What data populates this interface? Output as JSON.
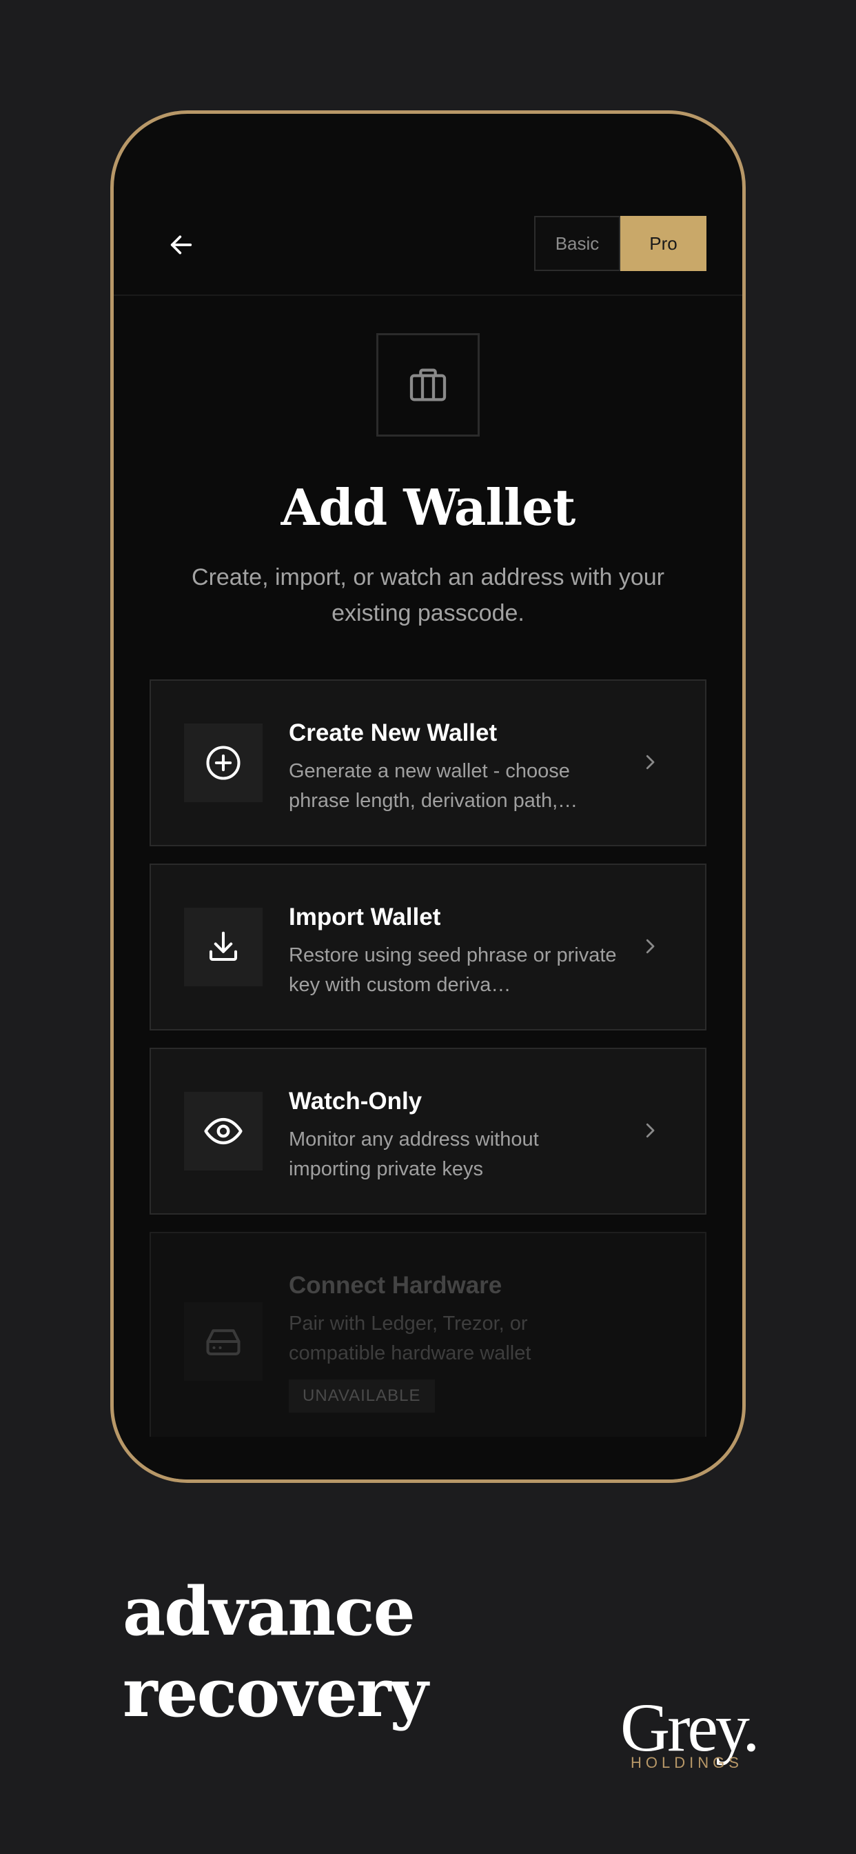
{
  "header": {
    "back_label": "Back",
    "mode_basic": "Basic",
    "mode_pro": "Pro",
    "active_mode": "Pro"
  },
  "hero": {
    "icon": "wallet-icon",
    "title": "Add Wallet",
    "subtitle": "Create, import, or watch an address with your existing passcode."
  },
  "options": [
    {
      "icon": "plus-circle-icon",
      "title": "Create New Wallet",
      "description": "Generate a new wallet - choose phrase length, derivation path,…"
    },
    {
      "icon": "download-icon",
      "title": "Import Wallet",
      "description": "Restore using seed phrase or private key with custom deriva…"
    },
    {
      "icon": "eye-icon",
      "title": "Watch-Only",
      "description": "Monitor any address without importing private keys"
    },
    {
      "icon": "hard-drive-icon",
      "title": "Connect Hardware",
      "description": "Pair with Ledger, Trezor, or compatible hardware wallet",
      "badge": "UNAVAILABLE"
    }
  ],
  "tagline": {
    "line1": "advance",
    "line2": "recovery"
  },
  "brand": {
    "name": "Grey.",
    "sub": "HOLDINGS"
  },
  "colors": {
    "background": "#1c1c1e",
    "phone_frame": "#b89868",
    "accent": "#c9a869",
    "card": "#151515"
  }
}
